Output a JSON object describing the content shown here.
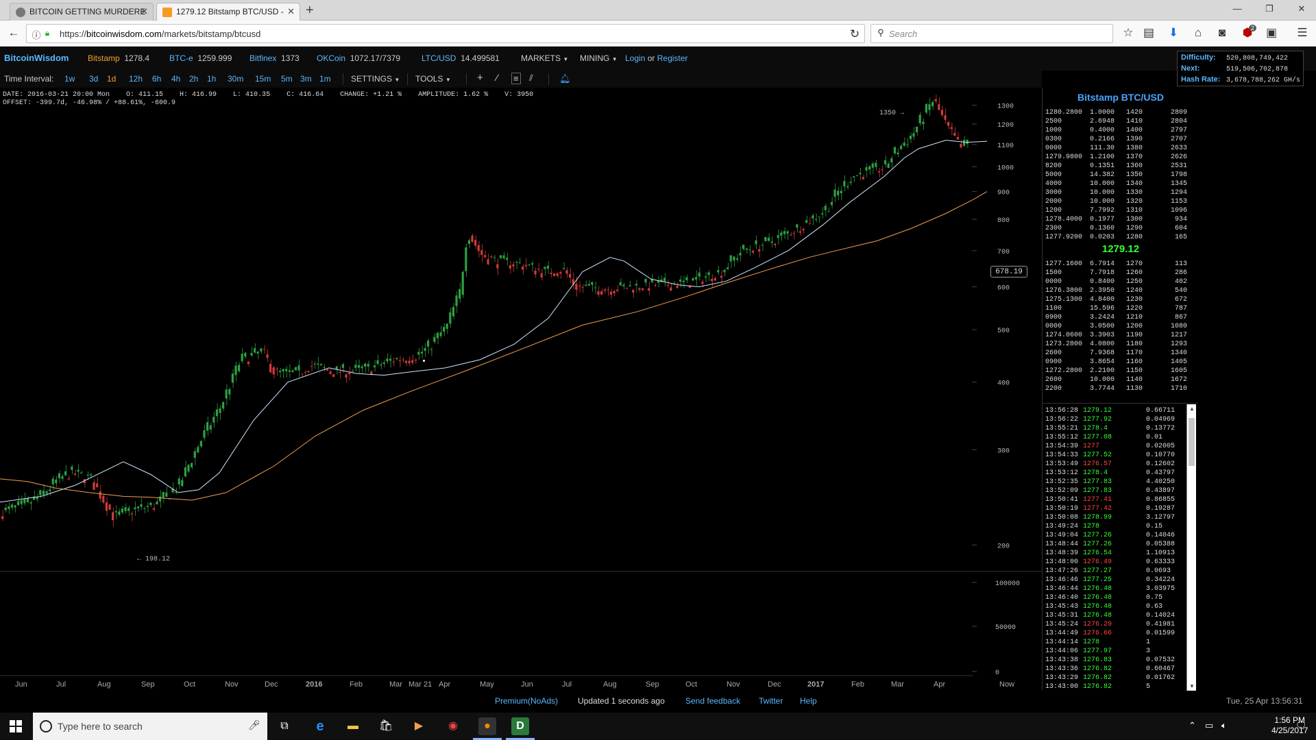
{
  "browser": {
    "tabs": [
      {
        "title": "BITCOIN GETTING MURDERE",
        "active": false
      },
      {
        "title": "1279.12 Bitstamp BTC/USD -",
        "active": true
      }
    ],
    "url_prefix": "https://",
    "url_host": "bitcoinwisdom.com",
    "url_path": "/markets/bitstamp/btcusd",
    "search_placeholder": "Search",
    "download_badge": "2"
  },
  "site": {
    "brand": "BitcoinWisdom",
    "markets": [
      {
        "name": "Bitstamp",
        "price": "1278.4"
      },
      {
        "name": "BTC-e",
        "price": "1259.999"
      },
      {
        "name": "Bitfinex",
        "price": "1373"
      },
      {
        "name": "OKCoin",
        "price": "1072.17/7379"
      },
      {
        "name": "LTC/USD",
        "price": "14.499581"
      }
    ],
    "menu_markets": "MARKETS",
    "menu_mining": "MINING",
    "login": "Login",
    "or": "or",
    "register": "Register"
  },
  "mining": {
    "difficulty_label": "Difficulty:",
    "difficulty": "520,808,749,422",
    "next_label": "Next:",
    "next": "519,506,702,878",
    "hashrate_label": "Hash Rate:",
    "hashrate": "3,678,788,262 GH/s"
  },
  "toolbar": {
    "label": "Time Interval:",
    "intervals": [
      "1w",
      "3d",
      "1d",
      "12h",
      "6h",
      "4h",
      "2h",
      "1h",
      "30m",
      "15m",
      "5m",
      "3m",
      "1m"
    ],
    "settings": "SETTINGS",
    "tools": "TOOLS"
  },
  "info": {
    "line1": "DATE: 2016-03-21 20:00 Mon    O: 411.15    H: 416.99    L: 410.35    C: 416.64    CHANGE: +1.21 %    AMPLITUDE: 1.62 %    V: 3950",
    "line2": "OFFSET: -399.7d, -46.98% / +88.61%, -600.9"
  },
  "chart_data": {
    "type": "candlestick",
    "yscale": "log",
    "ylim": [
      190,
      1360
    ],
    "yticks": [
      1300,
      1200,
      1100,
      1000,
      900,
      800,
      700,
      600,
      500,
      400,
      300,
      200
    ],
    "xticks": [
      "Jun",
      "Jul",
      "Aug",
      "Sep",
      "Oct",
      "Nov",
      "Dec",
      "2016",
      "Feb",
      "Mar",
      "Mar 21",
      "Apr",
      "May",
      "Jun",
      "Jul",
      "Aug",
      "Sep",
      "Oct",
      "Nov",
      "Dec",
      "2017",
      "Feb",
      "Mar",
      "Apr",
      "Now"
    ],
    "high_label": "1350",
    "low_label": "198.12",
    "cursor_price": "678.19",
    "close_path": [
      [
        0,
        230
      ],
      [
        30,
        236
      ],
      [
        55,
        245
      ],
      [
        80,
        262
      ],
      [
        100,
        272
      ],
      [
        130,
        265
      ],
      [
        165,
        225
      ],
      [
        190,
        232
      ],
      [
        225,
        237
      ],
      [
        260,
        258
      ],
      [
        290,
        310
      ],
      [
        320,
        360
      ],
      [
        350,
        440
      ],
      [
        380,
        455
      ],
      [
        400,
        415
      ],
      [
        430,
        415
      ],
      [
        450,
        430
      ],
      [
        470,
        423
      ],
      [
        480,
        418
      ],
      [
        510,
        420
      ],
      [
        540,
        425
      ],
      [
        570,
        440
      ],
      [
        600,
        445
      ],
      [
        620,
        460
      ],
      [
        650,
        505
      ],
      [
        670,
        590
      ],
      [
        680,
        760
      ],
      [
        700,
        690
      ],
      [
        720,
        670
      ],
      [
        740,
        665
      ],
      [
        760,
        660
      ],
      [
        790,
        640
      ],
      [
        820,
        645
      ],
      [
        840,
        600
      ],
      [
        880,
        595
      ],
      [
        920,
        600
      ],
      [
        950,
        605
      ],
      [
        1000,
        610
      ],
      [
        1050,
        640
      ],
      [
        1080,
        700
      ],
      [
        1120,
        725
      ],
      [
        1160,
        770
      ],
      [
        1200,
        830
      ],
      [
        1240,
        960
      ],
      [
        1290,
        1000
      ],
      [
        1300,
        1050
      ],
      [
        1330,
        1150
      ],
      [
        1350,
        1270
      ],
      [
        1360,
        1330
      ],
      [
        1380,
        1180
      ],
      [
        1400,
        1080
      ],
      [
        1420,
        1150
      ],
      [
        1440,
        1230
      ],
      [
        1460,
        1270
      ],
      [
        1480,
        1278
      ],
      [
        1510,
        1280
      ],
      [
        1520,
        1279
      ]
    ],
    "ma_short": [
      [
        0,
        240
      ],
      [
        60,
        246
      ],
      [
        110,
        258
      ],
      [
        180,
        285
      ],
      [
        220,
        270
      ],
      [
        260,
        250
      ],
      [
        290,
        253
      ],
      [
        320,
        272
      ],
      [
        370,
        340
      ],
      [
        420,
        400
      ],
      [
        480,
        425
      ],
      [
        520,
        415
      ],
      [
        560,
        412
      ],
      [
        600,
        418
      ],
      [
        650,
        425
      ],
      [
        700,
        440
      ],
      [
        750,
        470
      ],
      [
        800,
        525
      ],
      [
        850,
        640
      ],
      [
        890,
        680
      ],
      [
        910,
        670
      ],
      [
        950,
        620
      ],
      [
        990,
        605
      ],
      [
        1020,
        600
      ],
      [
        1060,
        615
      ],
      [
        1100,
        650
      ],
      [
        1150,
        700
      ],
      [
        1200,
        780
      ],
      [
        1240,
        860
      ],
      [
        1290,
        960
      ],
      [
        1320,
        1040
      ],
      [
        1340,
        1080
      ],
      [
        1380,
        1120
      ],
      [
        1410,
        1110
      ],
      [
        1440,
        1115
      ]
    ],
    "ma_long": [
      [
        0,
        265
      ],
      [
        40,
        262
      ],
      [
        80,
        255
      ],
      [
        130,
        250
      ],
      [
        180,
        246
      ],
      [
        220,
        245
      ],
      [
        280,
        242
      ],
      [
        330,
        250
      ],
      [
        400,
        280
      ],
      [
        460,
        318
      ],
      [
        530,
        355
      ],
      [
        600,
        385
      ],
      [
        680,
        420
      ],
      [
        760,
        460
      ],
      [
        850,
        510
      ],
      [
        930,
        540
      ],
      [
        1000,
        575
      ],
      [
        1060,
        610
      ],
      [
        1120,
        645
      ],
      [
        1180,
        680
      ],
      [
        1220,
        700
      ],
      [
        1280,
        730
      ],
      [
        1330,
        770
      ],
      [
        1380,
        820
      ],
      [
        1420,
        870
      ],
      [
        1440,
        900
      ]
    ],
    "volume_ticks": [
      "100000",
      "50000",
      "0"
    ]
  },
  "orderbook": {
    "title": "Bitstamp BTC/USD",
    "asks": [
      [
        "1280.2800",
        "1.0000",
        "1420",
        "2809"
      ],
      [
        "2500",
        "2.6948",
        "1410",
        "2804"
      ],
      [
        "1000",
        "0.4000",
        "1400",
        "2797"
      ],
      [
        "0300",
        "0.2166",
        "1390",
        "2707"
      ],
      [
        "0000",
        "111.30",
        "1380",
        "2633"
      ],
      [
        "1279.9800",
        "1.2100",
        "1370",
        "2626"
      ],
      [
        "8200",
        "0.1351",
        "1360",
        "2531"
      ],
      [
        "5000",
        "14.382",
        "1350",
        "1798"
      ],
      [
        "4000",
        "10.000",
        "1340",
        "1345"
      ],
      [
        "3000",
        "10.000",
        "1330",
        "1294"
      ],
      [
        "2000",
        "10.000",
        "1320",
        "1153"
      ],
      [
        "1200",
        "7.7992",
        "1310",
        "1096"
      ],
      [
        "1278.4000",
        "0.1977",
        "1300",
        "934"
      ],
      [
        "2300",
        "0.1360",
        "1290",
        "604"
      ],
      [
        "1277.9200",
        "0.0203",
        "1280",
        "165"
      ]
    ],
    "mid": "1279.12",
    "bids": [
      [
        "1277.1600",
        "6.7914",
        "1270",
        "113"
      ],
      [
        "1500",
        "7.7918",
        "1260",
        "286"
      ],
      [
        "0000",
        "0.8400",
        "1250",
        "402"
      ],
      [
        "1276.3800",
        "2.3950",
        "1240",
        "540"
      ],
      [
        "1275.1300",
        "4.8400",
        "1230",
        "672"
      ],
      [
        "1100",
        "15.596",
        "1220",
        "787"
      ],
      [
        "0900",
        "3.2424",
        "1210",
        "867"
      ],
      [
        "0000",
        "3.0500",
        "1200",
        "1080"
      ],
      [
        "1274.0600",
        "3.3903",
        "1190",
        "1217"
      ],
      [
        "1273.2800",
        "4.0800",
        "1180",
        "1293"
      ],
      [
        "2600",
        "7.9368",
        "1170",
        "1340"
      ],
      [
        "0900",
        "3.8654",
        "1160",
        "1405"
      ],
      [
        "1272.2800",
        "2.2100",
        "1150",
        "1605"
      ],
      [
        "2600",
        "10.000",
        "1140",
        "1672"
      ],
      [
        "2200",
        "3.7744",
        "1130",
        "1710"
      ]
    ]
  },
  "trades": [
    [
      "13:56:28",
      "1279.12",
      "0.66711",
      "up"
    ],
    [
      "13:56:22",
      "1277.92",
      "0.04969",
      "up"
    ],
    [
      "13:55:21",
      "1278.4",
      "0.13772",
      "up"
    ],
    [
      "13:55:12",
      "1277.08",
      "0.01",
      "up"
    ],
    [
      "13:54:39",
      "1277",
      "0.02005",
      "dn"
    ],
    [
      "13:54:33",
      "1277.52",
      "0.10770",
      "up"
    ],
    [
      "13:53:49",
      "1276.57",
      "0.12602",
      "dn"
    ],
    [
      "13:53:12",
      "1278.4",
      "0.43797",
      "up"
    ],
    [
      "13:52:35",
      "1277.83",
      "4.40250",
      "up"
    ],
    [
      "13:52:09",
      "1277.83",
      "0.43897",
      "up"
    ],
    [
      "13:50:41",
      "1277.41",
      "0.86855",
      "dn"
    ],
    [
      "13:50:19",
      "1277.42",
      "0.19287",
      "dn"
    ],
    [
      "13:50:08",
      "1278.99",
      "3.12797",
      "up"
    ],
    [
      "13:49:24",
      "1278",
      "0.15",
      "up"
    ],
    [
      "13:49:04",
      "1277.26",
      "0.14046",
      "up"
    ],
    [
      "13:48:44",
      "1277.26",
      "0.05388",
      "up"
    ],
    [
      "13:48:39",
      "1276.54",
      "1.10913",
      "up"
    ],
    [
      "13:48:00",
      "1276.49",
      "0.63333",
      "dn"
    ],
    [
      "13:47:26",
      "1277.27",
      "0.0693",
      "up"
    ],
    [
      "13:46:46",
      "1277.25",
      "0.34224",
      "up"
    ],
    [
      "13:46:44",
      "1276.48",
      "3.03975",
      "up"
    ],
    [
      "13:46:40",
      "1276.48",
      "0.75",
      "up"
    ],
    [
      "13:45:43",
      "1276.48",
      "0.63",
      "up"
    ],
    [
      "13:45:31",
      "1276.48",
      "0.14024",
      "up"
    ],
    [
      "13:45:24",
      "1276.29",
      "0.41981",
      "dn"
    ],
    [
      "13:44:49",
      "1276.66",
      "0.01599",
      "dn"
    ],
    [
      "13:44:14",
      "1278",
      "1",
      "up"
    ],
    [
      "13:44:06",
      "1277.97",
      "3",
      "up"
    ],
    [
      "13:43:38",
      "1276.83",
      "0.07532",
      "up"
    ],
    [
      "13:43:36",
      "1276.82",
      "0.60467",
      "up"
    ],
    [
      "13:43:29",
      "1276.82",
      "0.01762",
      "up"
    ],
    [
      "13:43:00",
      "1276.82",
      "5",
      "up"
    ]
  ],
  "footer": {
    "premium": "Premium(NoAds)",
    "updated": "Updated 1 seconds ago",
    "feedback": "Send feedback",
    "twitter": "Twitter",
    "help": "Help",
    "datetime": "Tue, 25 Apr 13:56:31"
  },
  "taskbar": {
    "search_placeholder": "Type here to search",
    "time": "1:56 PM",
    "date": "4/25/2017"
  },
  "colors": {
    "accent": "#4aa3ff",
    "up": "#33ff33",
    "down": "#ff4444",
    "ma_short": "#cfe8ff",
    "ma_long": "#f0a050"
  }
}
